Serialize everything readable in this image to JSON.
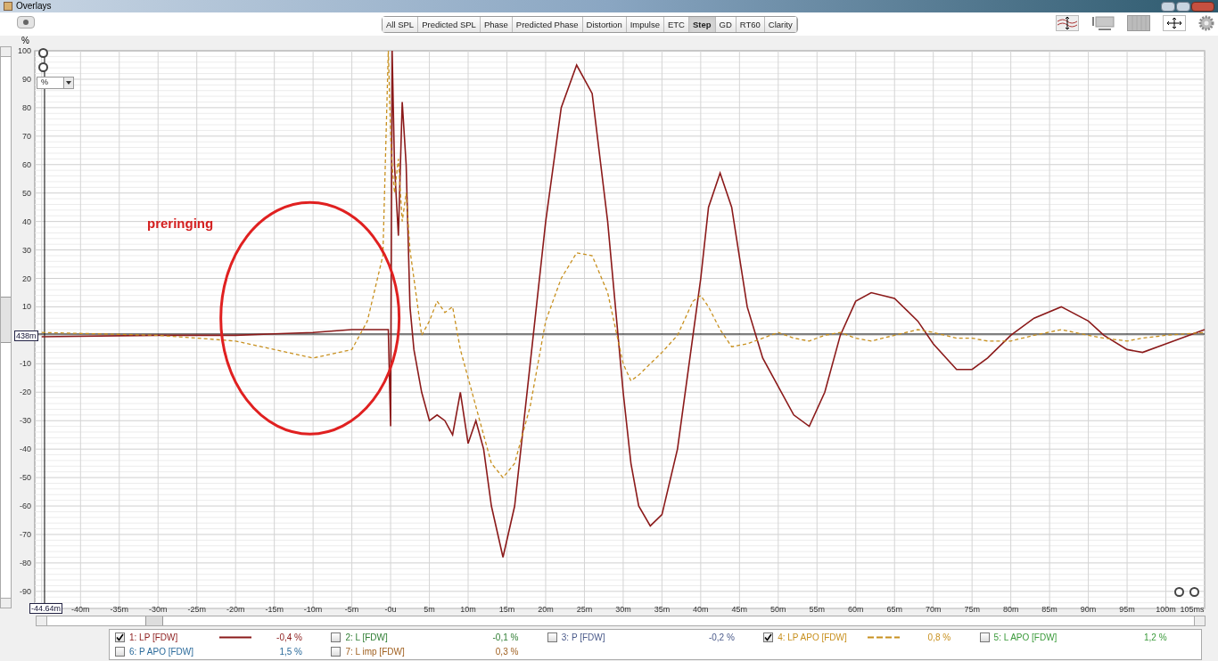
{
  "window": {
    "title": "Overlays"
  },
  "tabs": [
    {
      "label": "All SPL",
      "selected": false
    },
    {
      "label": "Predicted SPL",
      "selected": false
    },
    {
      "label": "Phase",
      "selected": false
    },
    {
      "label": "Predicted Phase",
      "selected": false
    },
    {
      "label": "Distortion",
      "selected": false
    },
    {
      "label": "Impulse",
      "selected": false
    },
    {
      "label": "ETC",
      "selected": false
    },
    {
      "label": "Step",
      "selected": true
    },
    {
      "label": "GD",
      "selected": false
    },
    {
      "label": "RT60",
      "selected": false
    },
    {
      "label": "Clarity",
      "selected": false
    }
  ],
  "unit_selector": {
    "value": "%"
  },
  "cursor": {
    "y_readout": "438m",
    "x_readout": "-44.64m"
  },
  "chart_data": {
    "type": "line",
    "ylabel": "%",
    "xlim": [
      -45.9,
      105
    ],
    "ylim": [
      -96,
      100
    ],
    "grid": true,
    "ref_lines": [
      {
        "axis": "x",
        "value": -44.64
      },
      {
        "axis": "y",
        "value": 0.438
      }
    ],
    "yticks": [
      -90,
      -80,
      -70,
      -60,
      -50,
      -40,
      -30,
      -20,
      -10,
      10,
      20,
      30,
      40,
      50,
      60,
      70,
      80,
      90,
      100
    ],
    "xticks": [
      {
        "value": -40,
        "label": "-40m"
      },
      {
        "value": -35,
        "label": "-35m"
      },
      {
        "value": -30,
        "label": "-30m"
      },
      {
        "value": -25,
        "label": "-25m"
      },
      {
        "value": -20,
        "label": "-20m"
      },
      {
        "value": -15,
        "label": "-15m"
      },
      {
        "value": -10,
        "label": "-10m"
      },
      {
        "value": -5,
        "label": "-5m"
      },
      {
        "value": 0,
        "label": "-0u"
      },
      {
        "value": 5,
        "label": "5m"
      },
      {
        "value": 10,
        "label": "10m"
      },
      {
        "value": 15,
        "label": "15m"
      },
      {
        "value": 20,
        "label": "20m"
      },
      {
        "value": 25,
        "label": "25m"
      },
      {
        "value": 30,
        "label": "30m"
      },
      {
        "value": 35,
        "label": "35m"
      },
      {
        "value": 40,
        "label": "40m"
      },
      {
        "value": 45,
        "label": "45m"
      },
      {
        "value": 50,
        "label": "50m"
      },
      {
        "value": 55,
        "label": "55m"
      },
      {
        "value": 60,
        "label": "60m"
      },
      {
        "value": 65,
        "label": "65m"
      },
      {
        "value": 70,
        "label": "70m"
      },
      {
        "value": 75,
        "label": "75m"
      },
      {
        "value": 80,
        "label": "80m"
      },
      {
        "value": 85,
        "label": "85m"
      },
      {
        "value": 90,
        "label": "90m"
      },
      {
        "value": 95,
        "label": "95m"
      },
      {
        "value": 100,
        "label": "100m"
      },
      {
        "value": 105,
        "label": "105ms"
      }
    ],
    "x": [
      -45,
      -30,
      -20,
      -15,
      -10,
      -5,
      -3,
      -1,
      -0.3,
      0,
      0.2,
      0.5,
      1,
      1.5,
      2,
      2.5,
      3,
      4,
      5,
      6,
      7,
      8,
      9,
      10,
      11,
      12,
      13,
      14.5,
      16,
      18,
      20,
      22,
      24,
      26,
      28,
      30,
      31,
      32,
      33.5,
      35,
      37,
      39,
      40,
      41,
      42.5,
      44,
      46,
      48,
      50,
      52,
      54,
      56,
      58,
      60,
      62,
      65,
      68,
      70,
      73,
      75,
      77,
      80,
      83,
      86.5,
      90,
      92,
      95,
      97,
      100,
      105
    ],
    "series": [
      {
        "name": "1: LP [FDW]",
        "color": "#8b1a1a",
        "line_style": "solid",
        "values": [
          -0.5,
          0,
          0,
          0.5,
          1,
          2,
          2,
          2,
          2,
          -32,
          100,
          60,
          35,
          82,
          60,
          10,
          -5,
          -20,
          -30,
          -28,
          -30,
          -35,
          -20,
          -38,
          -30,
          -40,
          -60,
          -78,
          -60,
          -10,
          40,
          80,
          95,
          85,
          40,
          -20,
          -45,
          -60,
          -67,
          -63,
          -40,
          0,
          20,
          45,
          57,
          45,
          10,
          -8,
          -18,
          -28,
          -32,
          -20,
          0,
          12,
          15,
          13,
          5,
          -3,
          -12,
          -12,
          -8,
          0,
          6,
          10,
          5,
          0,
          -5,
          -6,
          -3,
          2
        ]
      },
      {
        "name": "4: LP APO [FDW]",
        "color": "#c8901e",
        "line_style": "dashed",
        "values": [
          1,
          0,
          -2,
          -5,
          -8,
          -5,
          5,
          28,
          100,
          70,
          60,
          50,
          62,
          40,
          50,
          30,
          20,
          0,
          5,
          12,
          8,
          10,
          -5,
          -15,
          -25,
          -35,
          -45,
          -50,
          -45,
          -25,
          5,
          20,
          29,
          28,
          15,
          -10,
          -16,
          -14,
          -10,
          -6,
          0,
          12,
          14,
          10,
          2,
          -4,
          -3,
          -1,
          1,
          -1,
          -2,
          0,
          1,
          -1,
          -2,
          0,
          2,
          1,
          -1,
          -1,
          -2,
          -2,
          0,
          2,
          0,
          -1,
          -2,
          -1,
          0,
          1
        ]
      }
    ],
    "annotations": [
      "preringing"
    ]
  },
  "legend": [
    {
      "checked": true,
      "value": "-0,4 %"
    },
    {
      "label": "2: L [FDW]",
      "checked": false,
      "color": "#2e7d32",
      "value": "-0,1 %"
    },
    {
      "label": "3: P [FDW]",
      "checked": false,
      "color": "#4a5a8a",
      "value": "-0,2 %"
    },
    {
      "checked": true,
      "value": "0,8 %"
    },
    {
      "label": "5: L APO [FDW]",
      "checked": false,
      "color": "#3a9a3a",
      "value": "1,2 %"
    },
    {
      "label": "6: P APO [FDW]",
      "checked": false,
      "color": "#2a6a9a",
      "value": "1,5 %"
    },
    {
      "label": "7: L imp [FDW]",
      "checked": false,
      "color": "#a06020",
      "value": "0,3 %"
    }
  ]
}
